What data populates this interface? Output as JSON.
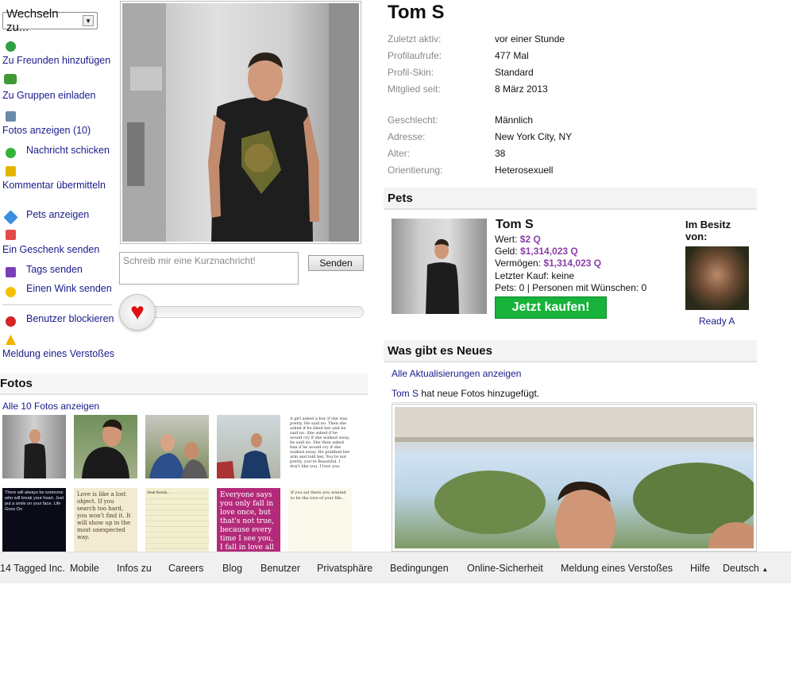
{
  "actions": {
    "switch_label": "Wechseln zu...",
    "add_friends": "Zu Freunden hinzufügen",
    "invite_groups": "Zu Gruppen einladen",
    "view_photos": "Fotos anzeigen (10)",
    "send_message": "Nachricht schicken",
    "send_comment": "Kommentar übermitteln",
    "view_pets": "Pets anzeigen",
    "send_gift": "Ein Geschenk senden",
    "send_tags": "Tags senden",
    "send_wink": "Einen Wink senden",
    "block_user": "Benutzer blockieren",
    "report": "Meldung eines Verstoßes"
  },
  "shout": {
    "placeholder": "Schreib mir eine Kurznachricht!",
    "send_label": "Senden"
  },
  "photos": {
    "title": "Fotos",
    "view_all": "Alle 10 Fotos anzeigen",
    "thumbs": [
      {
        "text": ""
      },
      {
        "text": ""
      },
      {
        "text": ""
      },
      {
        "text": ""
      },
      {
        "text": "A girl asked a boy if she was pretty. He said no. Then she asked if he liked her and he said no. She asked if he would cry if she walked away, he said no. She then asked him if he would cry if she walked away. He grabbed her arm and told her, You're not pretty, you're Beautiful. I don't like you, I love you."
      },
      {
        "text": "There will always be someone who will break your heart. Just put a smile on your face. Life Goes On"
      },
      {
        "text": "Love is like a lost object. If you search too hard, you won't find it. It will show up in the most unexpected way."
      },
      {
        "text": "Real friends..."
      },
      {
        "text": "Everyone says you only fall in love once, but that's not true, because every time I see you, I fall in love all over again."
      },
      {
        "text": "If you sat there you wanted to be the love of your life..."
      }
    ]
  },
  "profile": {
    "name": "Tom S",
    "info": [
      {
        "label": "Zuletzt aktiv:",
        "value": "vor einer Stunde"
      },
      {
        "label": "Profilaufrufe:",
        "value": "477 Mal"
      },
      {
        "label": "Profil-Skin:",
        "value": "Standard"
      },
      {
        "label": "Mitglied seit:",
        "value": "8 März 2013"
      },
      {
        "label": "Geschlecht:",
        "value": "Männlich"
      },
      {
        "label": "Adresse:",
        "value": "New York City, NY"
      },
      {
        "label": "Alter:",
        "value": "38"
      },
      {
        "label": "Orientierung:",
        "value": "Heterosexuell"
      }
    ]
  },
  "pets": {
    "title": "Pets",
    "name": "Tom S",
    "value_label": "Wert:",
    "value": "$2 Q",
    "cash_label": "Geld:",
    "cash": "$1,314,023 Q",
    "assets_label": "Vermögen:",
    "assets": "$1,314,023 Q",
    "last_buy": "Letzter Kauf: keine",
    "pets_line": "Pets: 0 | Personen mit Wünschen: 0",
    "buy_label": "Jetzt kaufen!",
    "owner_title": "Im Besitz von:",
    "owner_name": "Ready A"
  },
  "news": {
    "title": "Was gibt es Neues",
    "all_updates": "Alle Aktualisierungen anzeigen",
    "update_user": "Tom S",
    "update_text": " hat neue Fotos hinzugefügt."
  },
  "footer": {
    "copyright": "14 Tagged Inc.",
    "links": [
      "Mobile",
      "Infos zu",
      "Careers",
      "Blog",
      "Benutzer",
      "Privatsphäre",
      "Bedingungen",
      "Online-Sicherheit",
      "Meldung eines Verstoßes",
      "Hilfe"
    ],
    "language": "Deutsch"
  },
  "colors": {
    "link": "#1a1a8c",
    "buy": "#17b33a",
    "money": "#8a3fa8",
    "heart": "#d11111"
  }
}
